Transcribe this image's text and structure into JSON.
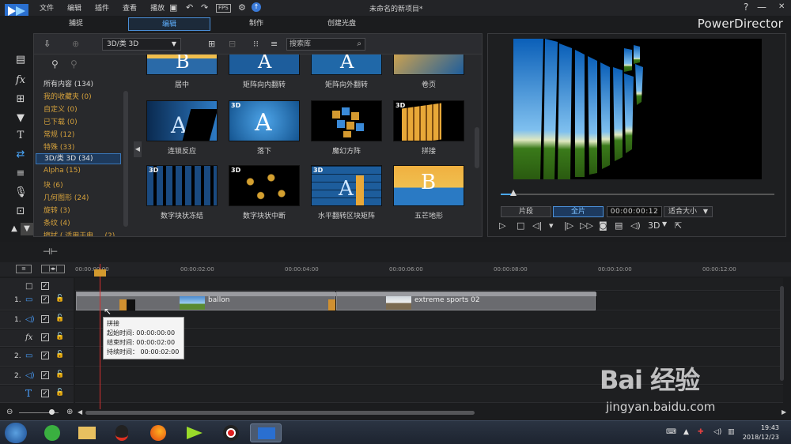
{
  "menu": [
    "文件",
    "编辑",
    "插件",
    "查看",
    "播放"
  ],
  "toolbar": {
    "fps": "FPS"
  },
  "window": {
    "title": "未命名的新项目*",
    "brand": "PowerDirector",
    "help": "?",
    "minimize": "—",
    "maximize": "□",
    "close": "✕"
  },
  "modes": [
    {
      "label": "捕捉",
      "active": false
    },
    {
      "label": "编辑",
      "active": true
    },
    {
      "label": "制作",
      "active": false
    },
    {
      "label": "创建光盘",
      "active": false
    }
  ],
  "library": {
    "category_select": "3D/类 3D",
    "search_placeholder": "搜索库",
    "categories": [
      {
        "label": "所有内容 (134)",
        "style": "white"
      },
      {
        "label": "我的收藏夹  (0)"
      },
      {
        "label": "自定义  (0)"
      },
      {
        "label": "已下载  (0)"
      },
      {
        "label": "常规  (12)"
      },
      {
        "label": "特殊  (33)"
      },
      {
        "label": "3D/类 3D  (34)",
        "selected": true
      },
      {
        "label": "Alpha  (15)"
      },
      {
        "label": "块  (6)"
      },
      {
        "label": "几何图形  (24)"
      },
      {
        "label": "旋转  (3)"
      },
      {
        "label": "条纹  (4)"
      },
      {
        "label": "擦拭 ( 适用于电 ...  (2)"
      }
    ],
    "thumbnails": [
      {
        "label": "居中",
        "badge": ""
      },
      {
        "label": "矩阵向内翻转",
        "badge": ""
      },
      {
        "label": "矩阵向外翻转",
        "badge": ""
      },
      {
        "label": "卷页",
        "badge": ""
      },
      {
        "label": "连锁反应",
        "badge": ""
      },
      {
        "label": "落下",
        "badge": "3D"
      },
      {
        "label": "魔幻方阵",
        "badge": ""
      },
      {
        "label": "拼接",
        "badge": "3D"
      },
      {
        "label": "数字块状冻结",
        "badge": "3D"
      },
      {
        "label": "数字块状中断",
        "badge": "3D"
      },
      {
        "label": "水平翻转区块矩阵",
        "badge": "3D"
      },
      {
        "label": "五芒地形",
        "badge": ""
      }
    ]
  },
  "preview": {
    "clip_btn": "片段",
    "full_btn": "全片",
    "timecode": "00:00:00:12",
    "zoom": "适合大小",
    "mode_3d": "3D",
    "progress": 0.04
  },
  "timeline": {
    "ruler": [
      "00:00:00:00",
      "00:00:02:00",
      "00:00:04:00",
      "00:00:06:00",
      "00:00:08:00",
      "00:00:10:00",
      "00:00:12:00"
    ],
    "tracks": [
      {
        "num": "",
        "icon": "□"
      },
      {
        "num": "1.",
        "icon": "▭"
      },
      {
        "num": "1.",
        "icon": "◁)"
      },
      {
        "num": "",
        "icon": "fx"
      },
      {
        "num": "2.",
        "icon": "▭"
      },
      {
        "num": "2.",
        "icon": "◁)"
      },
      {
        "num": "",
        "icon": "T"
      },
      {
        "num": "",
        "icon": "◎"
      }
    ],
    "clips": [
      {
        "label": "ballon"
      },
      {
        "label": "extreme sports 02"
      }
    ],
    "tooltip": {
      "title": "拼接",
      "start": "起始时间: 00:00:00:00",
      "end": "结束时间: 00:00:02:00",
      "duration": "持续时间： 00:00:02:00"
    }
  },
  "taskbar": {
    "time": "19:43",
    "date": "2018/12/23"
  },
  "watermark": {
    "text": "Bai 经验",
    "url": "jingyan.baidu.com"
  }
}
